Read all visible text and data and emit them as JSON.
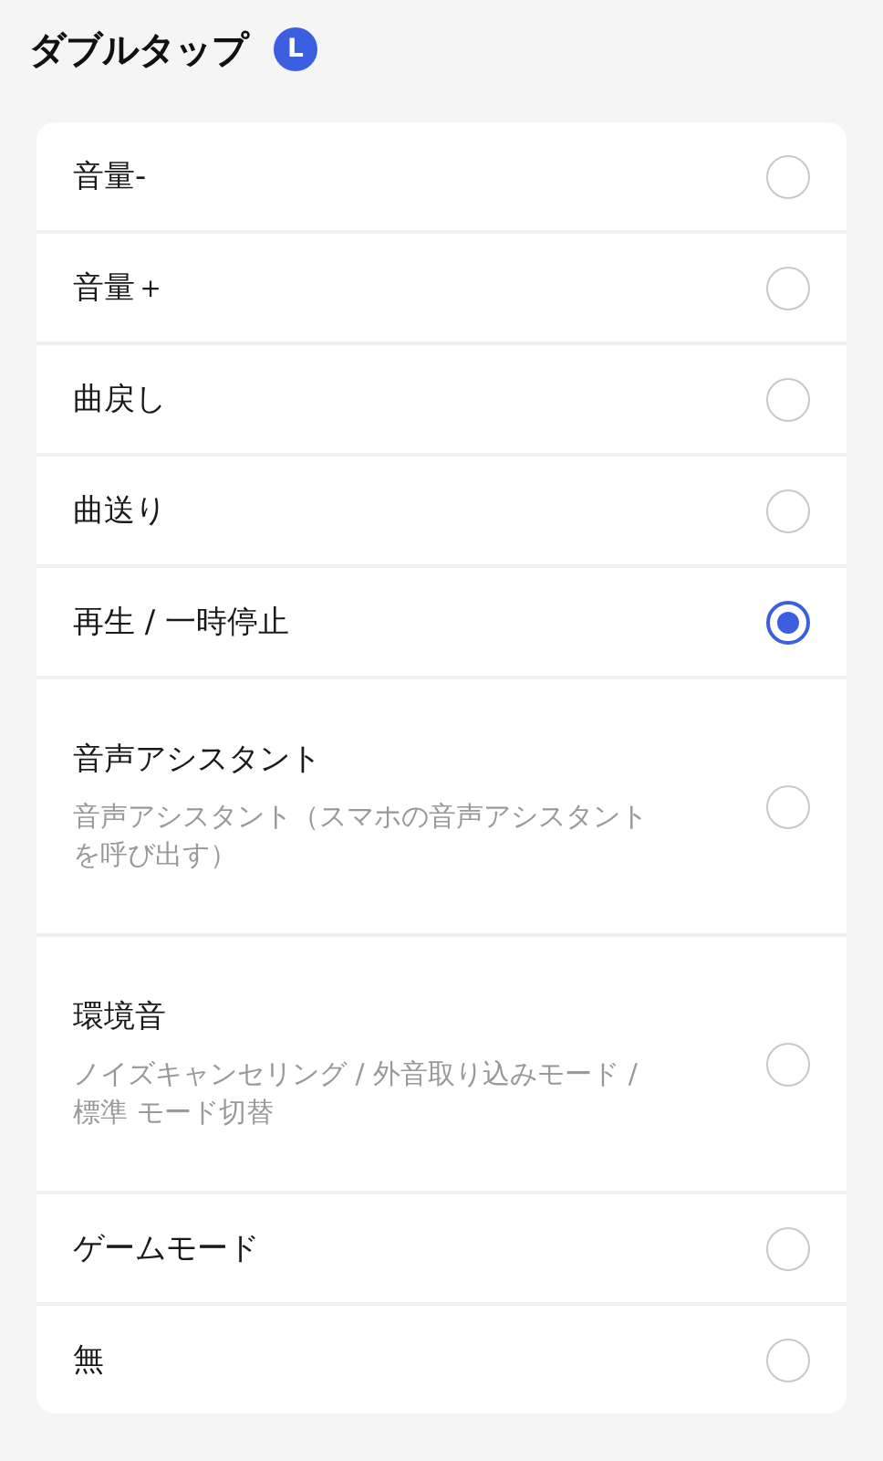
{
  "title": "ダブルタップ",
  "badge": "L",
  "options": [
    {
      "label": "音量-",
      "selected": false
    },
    {
      "label": "音量＋",
      "selected": false
    },
    {
      "label": "曲戻し",
      "selected": false
    },
    {
      "label": "曲送り",
      "selected": false
    },
    {
      "label": "再生 / 一時停止",
      "selected": true
    },
    {
      "label": "音声アシスタント",
      "description": "音声アシスタント（スマホの音声アシスタントを呼び出す）",
      "selected": false
    },
    {
      "label": "環境音",
      "description": "ノイズキャンセリング / 外音取り込みモード / 標準 モード切替",
      "selected": false
    },
    {
      "label": "ゲームモード",
      "selected": false
    },
    {
      "label": "無",
      "selected": false
    }
  ]
}
